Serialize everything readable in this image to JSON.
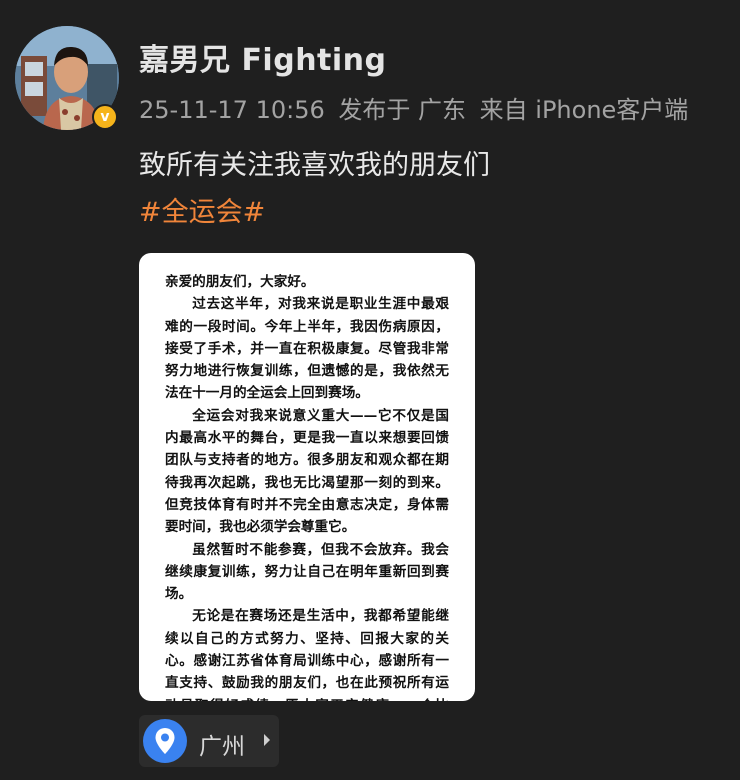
{
  "post": {
    "username": "嘉男兄 Fighting",
    "meta": {
      "timestamp": "25-11-17 10:56",
      "published_in": "发布于 广东",
      "source": "来自 iPhone客户端"
    },
    "text": "致所有关注我喜欢我的朋友们",
    "hashtag": "#全运会#",
    "verified_badge": "v",
    "accent_color": "#f0853a"
  },
  "letter": {
    "salutation": "亲爱的朋友们，大家好。",
    "paragraphs": [
      "过去这半年，对我来说是职业生涯中最艰难的一段时间。今年上半年，我因伤病原因，接受了手术，并一直在积极康复。尽管我非常努力地进行恢复训练，但遗憾的是，我依然无法在十一月的全运会上回到赛场。",
      "全运会对我来说意义重大——它不仅是国内最高水平的舞台，更是我一直以来想要回馈团队与支持者的地方。很多朋友和观众都在期待我再次起跳，我也无比渴望那一刻的到来。但竞技体育有时并不完全由意志决定，身体需要时间，我也必须学会尊重它。",
      "虽然暂时不能参赛，但我不会放弃。我会继续康复训练，努力让自己在明年重新回到赛场。",
      "无论是在赛场还是生活中，我都希望能继续以自己的方式努力、坚持、回报大家的关心。感谢江苏省体育局训练中心，感谢所有一直支持、鼓励我的朋友们，也在此预祝所有运动员取得好成绩，愿大家平安健康、一个比赛，我们赛场再见。"
    ]
  },
  "location": {
    "label": "广州",
    "icon": "location-pin-icon",
    "pin_color": "#3a82f0"
  }
}
